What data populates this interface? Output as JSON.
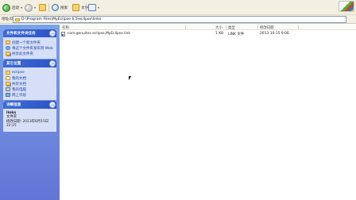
{
  "toolbar": {
    "back_label": "后退",
    "search_label": "搜索",
    "folders_label": "文件夹",
    "back_icon": "back-arrow-icon",
    "forward_icon": "forward-arrow-icon",
    "up_icon": "folder-up-icon",
    "search_icon": "search-magnifier-icon",
    "folders_icon": "folders-icon",
    "views_icon": "views-icon",
    "windows_logo_icon": "windows-logo-icon"
  },
  "address": {
    "label": "地址(D)",
    "value": "D:\\Program Files\\MyEclipse 6.5\\eclipse\\links"
  },
  "sidebar": {
    "tasks": {
      "title": "文件和文件夹任务",
      "items": [
        {
          "label": "创建一个新文件夹",
          "icon": "new-folder-icon"
        },
        {
          "label": "将这个文件夹发布到 Web",
          "icon": "publish-web-icon"
        },
        {
          "label": "共享此文件夹",
          "icon": "share-folder-icon"
        }
      ]
    },
    "places": {
      "title": "其它位置",
      "items": [
        {
          "label": "eclipse",
          "icon": "folder-icon"
        },
        {
          "label": "我的文档",
          "icon": "my-documents-icon"
        },
        {
          "label": "共享文档",
          "icon": "shared-documents-icon"
        },
        {
          "label": "我的电脑",
          "icon": "my-computer-icon"
        },
        {
          "label": "网上邻居",
          "icon": "network-places-icon"
        }
      ]
    },
    "details": {
      "title": "详细信息",
      "name": "links",
      "type": "文件夹",
      "modified_label": "修改日期:",
      "modified_value": "2013年6月15日",
      "modified_time": "22:25"
    }
  },
  "filelist": {
    "columns": [
      "名称",
      "大小",
      "类型",
      "修改日期"
    ],
    "rows": [
      {
        "name": "com.genuitec.eclipse.MyEclipse.link",
        "size": "1 KB",
        "type": "LINK 文件",
        "modified": "2013-10-15 9:06"
      }
    ]
  }
}
